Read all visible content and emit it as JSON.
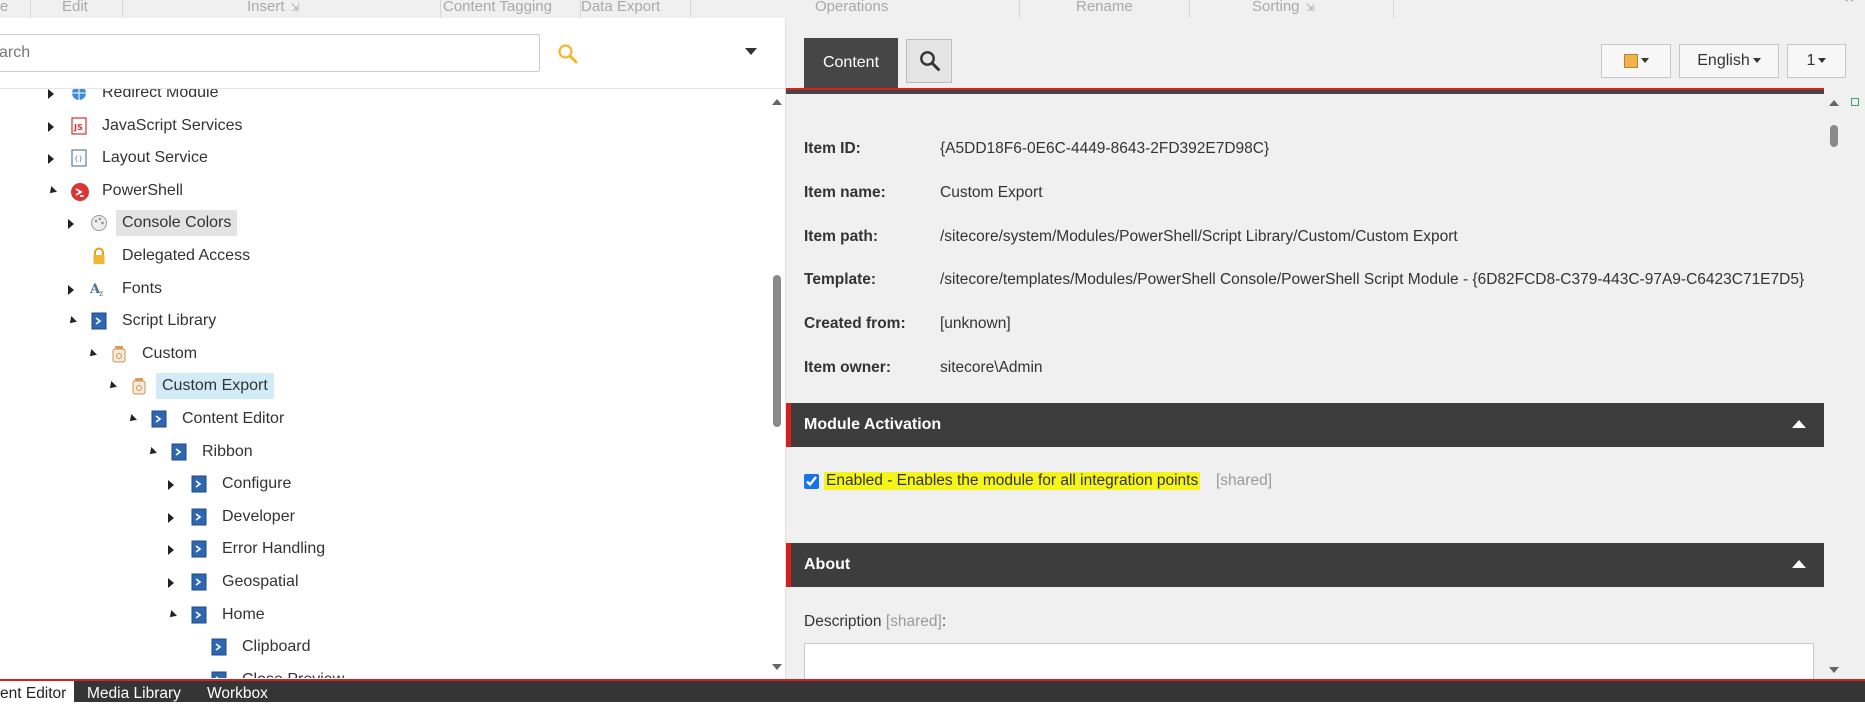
{
  "ribbon": {
    "groups": [
      {
        "label": "e",
        "has_expander": false
      },
      {
        "label": "Edit",
        "has_expander": false
      },
      {
        "label": "Insert",
        "has_expander": true
      },
      {
        "label": "Content Tagging",
        "has_expander": false
      },
      {
        "label": "Data Export",
        "has_expander": false
      },
      {
        "label": "Operations",
        "has_expander": false
      },
      {
        "label": "Rename",
        "has_expander": false
      },
      {
        "label": "Sorting",
        "has_expander": true
      }
    ],
    "collapse_icon": "chevron-up-icon"
  },
  "search": {
    "placeholder": "arch",
    "icon": "search-icon"
  },
  "tree": {
    "nodes": [
      {
        "label": "Redirect Module",
        "icon": "module-globe-icon",
        "state": "collapsed"
      },
      {
        "label": "JavaScript Services",
        "icon": "js-icon",
        "state": "collapsed"
      },
      {
        "label": "Layout Service",
        "icon": "layout-icon",
        "state": "collapsed"
      },
      {
        "label": "PowerShell",
        "icon": "powershell-icon",
        "state": "expanded"
      },
      {
        "label": "Console Colors",
        "icon": "palette-icon",
        "state": "collapsed",
        "hover": true
      },
      {
        "label": "Delegated Access",
        "icon": "lock-icon",
        "state": "none"
      },
      {
        "label": "Fonts",
        "icon": "font-icon",
        "state": "collapsed"
      },
      {
        "label": "Script Library",
        "icon": "script-icon",
        "state": "expanded"
      },
      {
        "label": "Custom",
        "icon": "jar-icon",
        "state": "expanded"
      },
      {
        "label": "Custom Export",
        "icon": "jar-icon",
        "state": "expanded",
        "selected": true
      },
      {
        "label": "Content Editor",
        "icon": "script-icon",
        "state": "expanded"
      },
      {
        "label": "Ribbon",
        "icon": "script-icon",
        "state": "expanded"
      },
      {
        "label": "Configure",
        "icon": "script-icon",
        "state": "collapsed"
      },
      {
        "label": "Developer",
        "icon": "script-icon",
        "state": "collapsed"
      },
      {
        "label": "Error Handling",
        "icon": "script-icon",
        "state": "collapsed"
      },
      {
        "label": "Geospatial",
        "icon": "script-icon",
        "state": "collapsed"
      },
      {
        "label": "Home",
        "icon": "script-icon",
        "state": "expanded"
      },
      {
        "label": "Clipboard",
        "icon": "script-icon",
        "state": "none"
      },
      {
        "label": "Close Preview",
        "icon": "script-icon",
        "state": "none"
      }
    ]
  },
  "editor": {
    "tab_label": "Content",
    "search_icon": "search-icon",
    "toolbar": {
      "save_icon": "save-icon",
      "language": "English",
      "version": "1"
    },
    "quick_info": [
      {
        "key": "Item ID:",
        "value": "{A5DD18F6-0E6C-4449-8643-2FD392E7D98C}"
      },
      {
        "key": "Item name:",
        "value": "Custom Export"
      },
      {
        "key": "Item path:",
        "value": "/sitecore/system/Modules/PowerShell/Script Library/Custom/Custom Export"
      },
      {
        "key": "Template:",
        "value": "/sitecore/templates/Modules/PowerShell Console/PowerShell Script Module - {6D82FCD8-C379-443C-97A9-C6423C71E7D5}"
      },
      {
        "key": "Created from:",
        "value": "[unknown]"
      },
      {
        "key": "Item owner:",
        "value": "sitecore\\Admin"
      }
    ],
    "sections": {
      "module_activation": {
        "title": "Module Activation",
        "field_label": "Enabled - Enables the module for all integration points",
        "field_shared": "[shared]",
        "checked": true
      },
      "about": {
        "title": "About",
        "description_label": "Description",
        "description_shared": "[shared]",
        "description_suffix": ":"
      }
    }
  },
  "bottom_tabs": [
    {
      "label": "ent Editor",
      "active": true
    },
    {
      "label": "Media Library",
      "active": false
    },
    {
      "label": "Workbox",
      "active": false
    }
  ],
  "colors": {
    "accent_red": "#d62020",
    "dark_header": "#3d3d3d",
    "highlight": "#f5f51a",
    "selection": "#d2ecf7"
  }
}
